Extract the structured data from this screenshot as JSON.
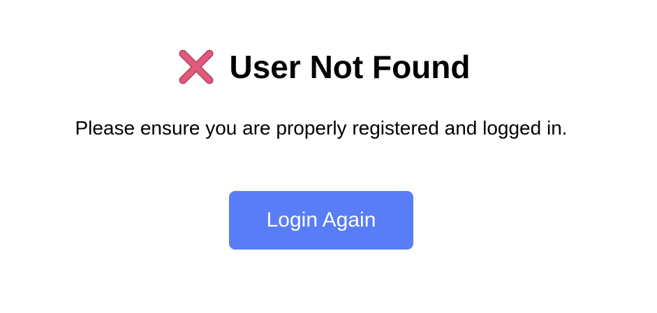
{
  "colors": {
    "accent": "#587df6",
    "error_icon": "#e05a7c",
    "background": "#ffffff",
    "text": "#000000"
  },
  "header": {
    "icon": "cross-mark-icon",
    "title": "User Not Found"
  },
  "message": "Please ensure you are properly registered and logged in.",
  "actions": {
    "login_label": "Login Again"
  }
}
